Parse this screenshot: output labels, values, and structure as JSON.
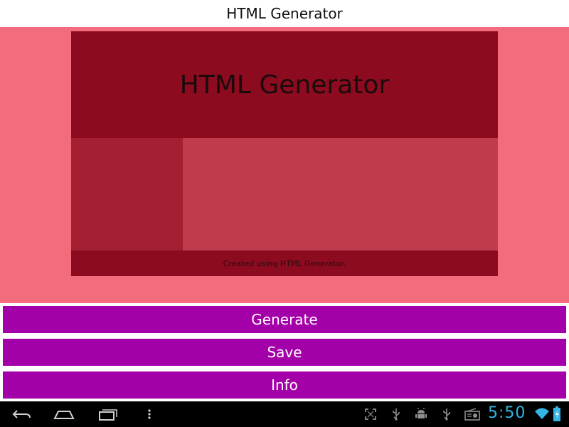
{
  "app": {
    "title": "HTML Generator"
  },
  "preview": {
    "header_text": "HTML Generator",
    "footer_text": "Created using HTML Generator."
  },
  "buttons": {
    "generate": "Generate",
    "save": "Save",
    "info": "Info"
  },
  "navbar": {
    "icons": [
      "back-icon",
      "home-icon",
      "recent-apps-icon",
      "menu-icon"
    ],
    "status_icons": [
      "fullscreen-icon",
      "usb-icon",
      "android-debug-icon",
      "usb-icon",
      "radio-icon",
      "wifi-icon",
      "battery-icon"
    ],
    "clock": "5:50"
  },
  "colors": {
    "preview_background": "#f26c7d",
    "preview_header": "#8c0b1e",
    "preview_sidebar": "#a51f33",
    "preview_main": "#c03c4d",
    "button": "#a400aa",
    "clock": "#33b5e5"
  }
}
